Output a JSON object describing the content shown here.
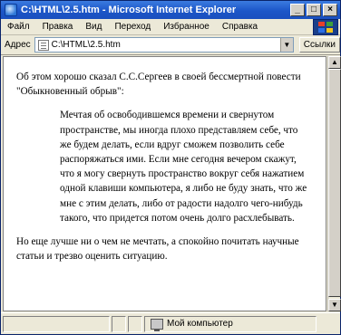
{
  "window": {
    "title": "C:\\HTML\\2.5.htm - Microsoft Internet Explorer",
    "btn_minimize": "_",
    "btn_maximize": "□",
    "btn_close": "×"
  },
  "menu": {
    "items": [
      {
        "label": "Файл"
      },
      {
        "label": "Правка"
      },
      {
        "label": "Вид"
      },
      {
        "label": "Переход"
      },
      {
        "label": "Избранное"
      },
      {
        "label": "Справка"
      }
    ]
  },
  "address": {
    "label": "Адрес",
    "value": "C:\\HTML\\2.5.htm",
    "links_label": "Ссылки"
  },
  "content": {
    "intro": "Об этом хорошо сказал С.С.Сергеев в своей бессмертной повести \"Обыкновенный обрыв\":",
    "quote": "Мечтая об освободившемся времени и свернутом пространстве, мы иногда плохо представляем себе, что же будем делать, если вдруг сможем позволить себе распоряжаться ими. Если мне сегодня вечером скажут, что я могу свернуть пространство вокруг себя нажатием одной клавиши компьютера, я либо не буду знать, что же мне с этим делать, либо от радости надолго чего-нибудь такого, что придется потом очень долго расхлебывать.",
    "closing": "Но еще лучше ни о чем не мечтать, а спокойно почитать научные статьи и трезво оценить ситуацию."
  },
  "status": {
    "zone": "Мой компьютер"
  }
}
